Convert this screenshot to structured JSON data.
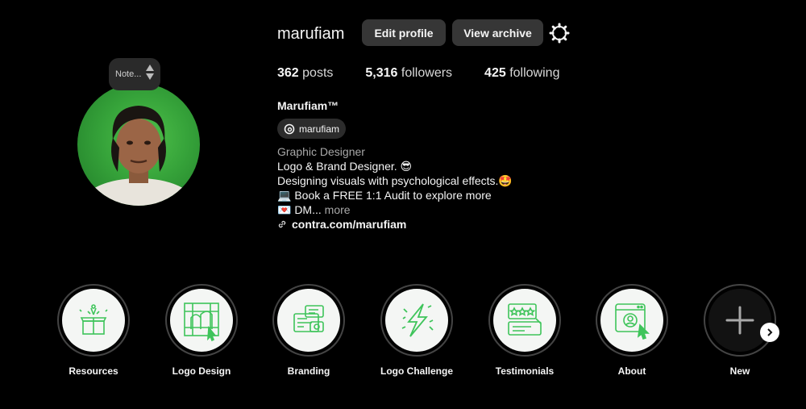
{
  "profile": {
    "username": "marufiam",
    "edit_label": "Edit profile",
    "archive_label": "View archive",
    "note": "Note...",
    "stats": {
      "posts_count": "362",
      "posts_label": "posts",
      "followers_count": "5,316",
      "followers_label": "followers",
      "following_count": "425",
      "following_label": "following"
    },
    "full_name": "Marufiam™",
    "threads_handle": "marufiam",
    "category": "Graphic Designer",
    "bio": {
      "line1": "Logo & Brand Designer. 😎",
      "line2": "Designing visuals with psychological effects.🤩",
      "line3": "💻 Book a FREE 1:1 Audit to explore more",
      "line4": "💌 DM...",
      "more": "more"
    },
    "link": "contra.com/marufiam"
  },
  "highlights": [
    {
      "label": "Resources",
      "icon": "gift-box-icon"
    },
    {
      "label": "Logo Design",
      "icon": "logo-grid-icon"
    },
    {
      "label": "Branding",
      "icon": "brand-cards-icon"
    },
    {
      "label": "Logo Challenge",
      "icon": "lightning-icon"
    },
    {
      "label": "Testimonials",
      "icon": "review-stars-icon"
    },
    {
      "label": "About",
      "icon": "profile-window-icon"
    },
    {
      "label": "New",
      "icon": "plus-icon"
    }
  ],
  "colors": {
    "background": "#000000",
    "button": "#363636",
    "accent_green": "#3ec45a",
    "muted_text": "#a8a8a8"
  }
}
